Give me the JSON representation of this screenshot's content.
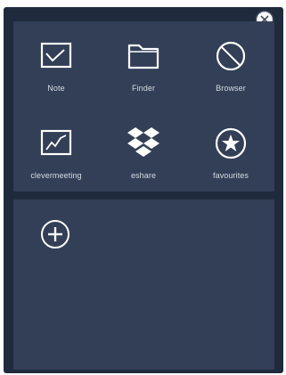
{
  "launcher": {
    "apps": [
      {
        "label": "Note",
        "icon": "note-icon"
      },
      {
        "label": "Finder",
        "icon": "folder-icon"
      },
      {
        "label": "Browser",
        "icon": "browser-icon"
      },
      {
        "label": "clevermeeting",
        "icon": "chart-icon"
      },
      {
        "label": "eshare",
        "icon": "dropbox-icon"
      },
      {
        "label": "favourites",
        "icon": "star-icon"
      }
    ]
  },
  "icons": {
    "close": "close-icon",
    "add": "add-icon"
  },
  "colors": {
    "panel_background": "#1f2a3d",
    "section_background": "#323f57",
    "icon_stroke": "#ffffff",
    "label_text": "#d6dbe4"
  }
}
